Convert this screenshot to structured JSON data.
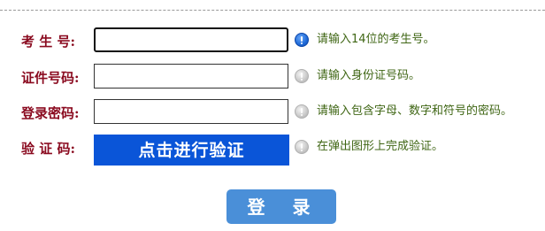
{
  "form": {
    "fields": [
      {
        "label": "考 生 号:",
        "value": "",
        "hint": "请输入14位的考生号。",
        "hint_icon": "info-icon-active"
      },
      {
        "label": "证件号码:",
        "value": "",
        "hint": "请输入身份证号码。",
        "hint_icon": "info-icon-inactive"
      },
      {
        "label": "登录密码:",
        "value": "",
        "hint": "请输入包含字母、数字和符号的密码。",
        "hint_icon": "info-icon-inactive"
      },
      {
        "label": "验 证 码:",
        "button_label": "点击进行验证",
        "hint": "在弹出图形上完成验证。",
        "hint_icon": "info-icon-inactive"
      }
    ],
    "login_label": "登 录"
  },
  "colors": {
    "label": "#8a0a1f",
    "hint": "#3f6614",
    "verify_button": "#0a55d8",
    "login_button": "#4a8fd8"
  }
}
